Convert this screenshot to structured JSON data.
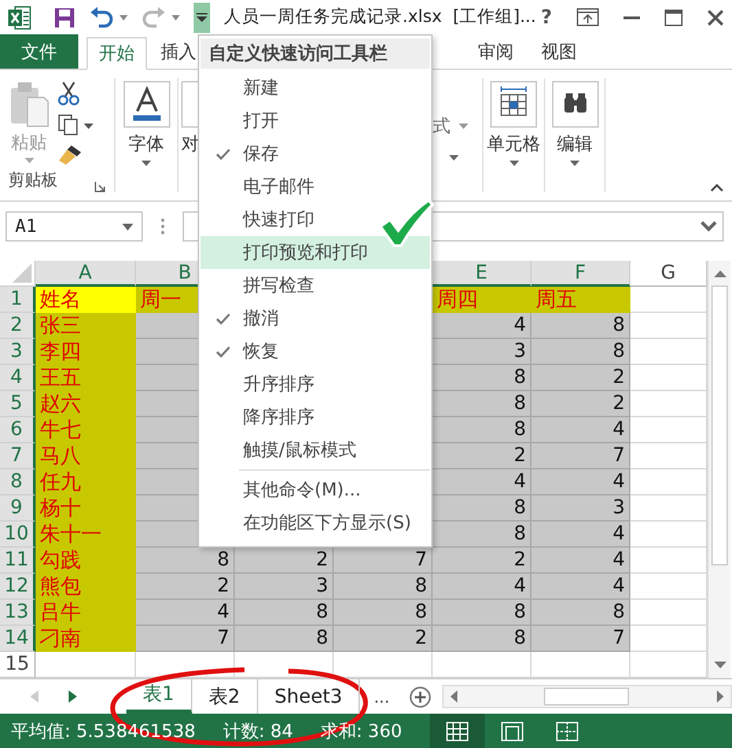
{
  "title_bar": {
    "title": "人员一周任务完成记录.xlsx  [工作组]...",
    "help": "?"
  },
  "quick_access": [
    {
      "kind": "save",
      "disabled": false
    },
    {
      "kind": "undo",
      "disabled": false
    },
    {
      "kind": "redo",
      "disabled": true
    }
  ],
  "customize_button": {
    "open": true
  },
  "ribbon_tabs": [
    {
      "label": "文件",
      "kind": "file",
      "selected": false
    },
    {
      "label": "开始",
      "kind": "tab",
      "selected": true
    },
    {
      "label": "插入",
      "kind": "tab",
      "selected": false
    },
    {
      "label": "审阅",
      "kind": "tab",
      "selected": false
    },
    {
      "label": "视图",
      "kind": "tab",
      "selected": false
    }
  ],
  "ribbon_groups": [
    {
      "kind": "clipboard",
      "button": "粘贴",
      "label": "剪贴板",
      "disabled": true
    },
    {
      "kind": "font",
      "button": "字体"
    },
    {
      "kind": "alignment",
      "button": "对"
    },
    {
      "kind": "styles",
      "button": "式"
    },
    {
      "kind": "cells",
      "button": "单元格"
    },
    {
      "kind": "editing",
      "button": "编辑"
    }
  ],
  "formula_bar": {
    "name_box": "A1"
  },
  "sheet": {
    "columns": [
      {
        "label": "A",
        "selected": true
      },
      {
        "label": "B",
        "selected": true
      },
      {
        "selected": true
      },
      {
        "selected": true
      },
      {
        "label": "E",
        "selected": true
      },
      {
        "label": "F",
        "selected": true
      },
      {
        "label": "G",
        "selected": false
      }
    ],
    "rows": [
      {
        "number": "1",
        "kind": "header",
        "selected": true,
        "active": true,
        "cells": [
          "姓名",
          "周一",
          null,
          null,
          "周四",
          "周五"
        ]
      },
      {
        "number": "2",
        "kind": "data",
        "selected": true,
        "active": false,
        "cells": [
          "张三",
          null,
          null,
          null,
          "4",
          "8"
        ]
      },
      {
        "number": "3",
        "kind": "data",
        "selected": true,
        "active": false,
        "cells": [
          "李四",
          null,
          null,
          null,
          "3",
          "8"
        ]
      },
      {
        "number": "4",
        "kind": "data",
        "selected": true,
        "active": false,
        "cells": [
          "王五",
          null,
          null,
          null,
          "8",
          "2"
        ]
      },
      {
        "number": "5",
        "kind": "data",
        "selected": true,
        "active": false,
        "cells": [
          "赵六",
          null,
          null,
          null,
          "8",
          "2"
        ]
      },
      {
        "number": "6",
        "kind": "data",
        "selected": true,
        "active": false,
        "cells": [
          "牛七",
          null,
          null,
          null,
          "8",
          "4"
        ]
      },
      {
        "number": "7",
        "kind": "data",
        "selected": true,
        "active": false,
        "cells": [
          "马八",
          null,
          null,
          null,
          "2",
          "7"
        ]
      },
      {
        "number": "8",
        "kind": "data",
        "selected": true,
        "active": false,
        "cells": [
          "任九",
          null,
          null,
          null,
          "4",
          "4"
        ]
      },
      {
        "number": "9",
        "kind": "data",
        "selected": true,
        "active": false,
        "cells": [
          "杨十",
          null,
          null,
          null,
          "8",
          "3"
        ]
      },
      {
        "number": "10",
        "kind": "data",
        "selected": true,
        "active": false,
        "cells": [
          "朱十一",
          null,
          null,
          null,
          "8",
          "4"
        ]
      },
      {
        "number": "11",
        "kind": "data",
        "selected": true,
        "active": false,
        "cells": [
          "勾践",
          "8",
          "2",
          "7",
          "2",
          "4"
        ]
      },
      {
        "number": "12",
        "kind": "data",
        "selected": true,
        "active": false,
        "cells": [
          "熊包",
          "2",
          "3",
          "8",
          "4",
          "4"
        ]
      },
      {
        "number": "13",
        "kind": "data",
        "selected": true,
        "active": false,
        "cells": [
          "吕牛",
          "4",
          "8",
          "8",
          "8",
          "8"
        ]
      },
      {
        "number": "14",
        "kind": "data",
        "selected": true,
        "active": false,
        "cells": [
          "刁南",
          "7",
          "8",
          "2",
          "8",
          "7"
        ]
      },
      {
        "number": "15",
        "kind": "data",
        "selected": false,
        "active": false,
        "cells": []
      }
    ]
  },
  "menu": {
    "title": "自定义快速访问工具栏",
    "items": [
      {
        "kind": "command",
        "label": "新建",
        "checked": false,
        "selected": false
      },
      {
        "kind": "command",
        "label": "打开",
        "checked": false,
        "selected": false
      },
      {
        "kind": "command",
        "label": "保存",
        "checked": true,
        "selected": false
      },
      {
        "kind": "command",
        "label": "电子邮件",
        "checked": false,
        "selected": false
      },
      {
        "kind": "command",
        "label": "快速打印",
        "checked": false,
        "selected": false
      },
      {
        "kind": "command",
        "label": "打印预览和打印",
        "checked": false,
        "selected": true
      },
      {
        "kind": "command",
        "label": "拼写检查",
        "checked": false,
        "selected": false
      },
      {
        "kind": "command",
        "label": "撤消",
        "checked": true,
        "selected": false
      },
      {
        "kind": "command",
        "label": "恢复",
        "checked": true,
        "selected": false
      },
      {
        "kind": "command",
        "label": "升序排序",
        "checked": false,
        "selected": false
      },
      {
        "kind": "command",
        "label": "降序排序",
        "checked": false,
        "selected": false
      },
      {
        "kind": "command",
        "label": "触摸/鼠标模式",
        "checked": false,
        "selected": false
      },
      {
        "kind": "separator"
      },
      {
        "kind": "command",
        "label": "其他命令(M)...",
        "checked": false,
        "selected": false
      },
      {
        "kind": "command",
        "label": "在功能区下方显示(S)",
        "checked": false,
        "selected": false
      }
    ]
  },
  "sheet_tabs": [
    {
      "label": "表1",
      "selected": true
    },
    {
      "label": "表2",
      "selected": false
    },
    {
      "label": "Sheet3",
      "selected": false
    }
  ],
  "more_tabs": "...",
  "status_bar": {
    "items": [
      "平均值: 5.538461538",
      "计数: 84",
      "求和: 360"
    ],
    "views": [
      {
        "kind": "normal",
        "selected": true
      },
      {
        "kind": "page_layout",
        "selected": false
      },
      {
        "kind": "page_break",
        "selected": false
      }
    ]
  },
  "annotations": {
    "checkmark": true,
    "ellipse": true
  }
}
